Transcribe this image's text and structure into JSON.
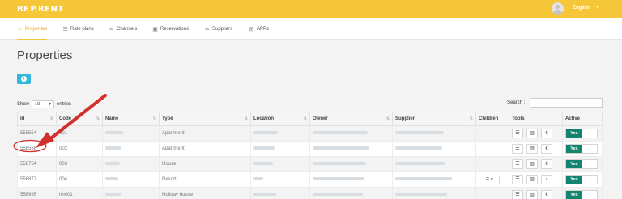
{
  "app": {
    "logo_text": "BE℗RENT",
    "language": "English",
    "language_caret": "▼"
  },
  "nav": [
    {
      "label": "Properties",
      "icon": "home-icon",
      "glyph": "⌂",
      "active": true
    },
    {
      "label": "Rate plans",
      "icon": "list-icon",
      "glyph": "☰",
      "active": false
    },
    {
      "label": "Channels",
      "icon": "share-icon",
      "glyph": "⋖",
      "active": false
    },
    {
      "label": "Reservations",
      "icon": "clipboard-icon",
      "glyph": "▣",
      "active": false
    },
    {
      "label": "Suppliers",
      "icon": "gear-icon",
      "glyph": "✻",
      "active": false
    },
    {
      "label": "APPs",
      "icon": "grid-icon",
      "glyph": "⊞",
      "active": false
    }
  ],
  "page": {
    "title": "Properties",
    "add_label": "+"
  },
  "table_controls": {
    "show_label": "Show",
    "show_value": "10",
    "entries_label": "entries",
    "search_label": "Search :"
  },
  "columns": [
    "Id",
    "Code",
    "Name",
    "Type",
    "Location",
    "Owner",
    "Supplier",
    "Children",
    "Tools",
    "Active"
  ],
  "rows": [
    {
      "id": "558554",
      "code": "001",
      "type": "Apartment",
      "children": "",
      "tools": [
        "list-icon",
        "image-icon",
        "euro-icon"
      ],
      "active": "Yes"
    },
    {
      "id": "558558",
      "code": "002",
      "type": "Apartment",
      "children": "",
      "tools": [
        "list-icon",
        "image-icon",
        "euro-icon"
      ],
      "active": "Yes"
    },
    {
      "id": "558754",
      "code": "003",
      "type": "House",
      "children": "",
      "tools": [
        "list-icon",
        "image-icon",
        "euro-icon"
      ],
      "active": "Yes"
    },
    {
      "id": "558877",
      "code": "004",
      "type": "Resort",
      "children": "☰ ▾",
      "tools": [
        "list-icon",
        "image-icon",
        "zoom-icon"
      ],
      "active": "Yes"
    },
    {
      "id": "558995",
      "code": "hh001",
      "type": "Holiday house",
      "children": "",
      "tools": [
        "list-icon",
        "image-icon",
        "euro-icon"
      ],
      "active": "Yes"
    }
  ],
  "tool_glyphs": {
    "list-icon": "☰",
    "image-icon": "▨",
    "euro-icon": "€",
    "zoom-icon": "⌕"
  },
  "colors": {
    "brand_yellow": "#f6c639",
    "add_button": "#35b7dd",
    "active_green": "#148471",
    "annotation_red": "#d2302b"
  }
}
